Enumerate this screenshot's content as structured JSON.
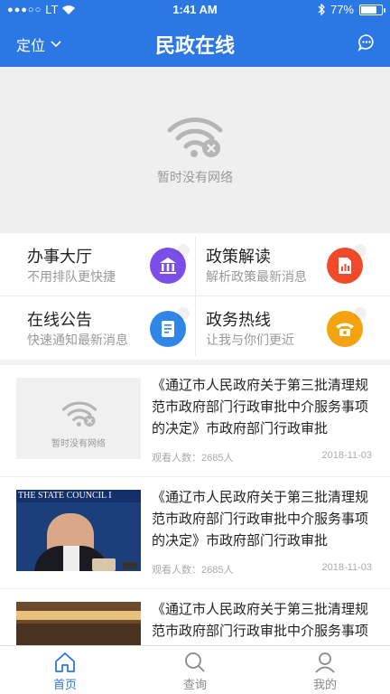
{
  "status_bar": {
    "carrier": "LT",
    "time": "1:41 AM",
    "battery": "77%"
  },
  "header": {
    "location_label": "定位",
    "title": "民政在线"
  },
  "banner": {
    "no_network": "暂时没有网络"
  },
  "services": [
    {
      "title": "办事大厅",
      "subtitle": "不用排队更快捷",
      "color": "#7b4ee8",
      "icon": "bank-icon"
    },
    {
      "title": "政策解读",
      "subtitle": "解析政策最新消息",
      "color": "#f04a2b",
      "icon": "document-chart-icon"
    },
    {
      "title": "在线公告",
      "subtitle": "快速通知最新消息",
      "color": "#2f86e6",
      "icon": "notice-icon"
    },
    {
      "title": "政务热线",
      "subtitle": "让我与你们更近",
      "color": "#f4a20e",
      "icon": "phone-icon"
    }
  ],
  "news": [
    {
      "headline": "《通辽市人民政府关于第三批清理规范市政府部门行政审批中介服务事项的决定》市政府部门行政审批",
      "views": "观看人数：2685人",
      "date": "2018-11-03",
      "thumb": "no-network",
      "thumb_text": "暂时没有网络"
    },
    {
      "headline": "《通辽市人民政府关于第三批清理规范市政府部门行政审批中介服务事项的决定》市政府部门行政审批",
      "views": "观看人数：2685人",
      "date": "2018-11-03",
      "thumb": "press-photo",
      "thumb_text": "THE STATE COUNCIL I"
    },
    {
      "headline": "《通辽市人民政府关于第三批清理规范市政府部门行政审批中介服务事项的决定》市政府部门行政审批",
      "views": "",
      "date": "",
      "thumb": "meeting-photo",
      "thumb_text": ""
    }
  ],
  "tabs": [
    {
      "label": "首页",
      "icon": "home-icon",
      "active": true
    },
    {
      "label": "查询",
      "icon": "search-icon",
      "active": false
    },
    {
      "label": "我的",
      "icon": "user-icon",
      "active": false
    }
  ],
  "colors": {
    "primary": "#2b78e4"
  }
}
